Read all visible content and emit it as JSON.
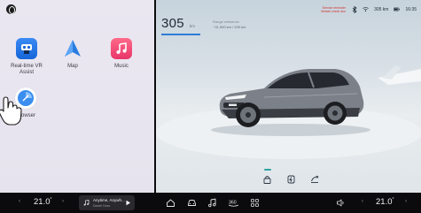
{
  "left_panel": {
    "apps": [
      {
        "label": "Real-time VR Assist",
        "icon": "vr-assist-icon"
      },
      {
        "label": "Map",
        "icon": "map-navigation-icon"
      },
      {
        "label": "Music",
        "icon": "music-note-icon"
      },
      {
        "label": "Browser",
        "icon": "browser-compass-icon"
      }
    ]
  },
  "main": {
    "range_value": "305",
    "range_unit": "km",
    "range_subtitle": "Range reference",
    "range_sub": "~31,900 km / 200 km",
    "status": {
      "warning_lines": [
        "Service reminder",
        "Vehicle check due"
      ],
      "range": "305 km",
      "time": "16:35"
    }
  },
  "dock": {
    "left_temp": "21.0",
    "right_temp": "21.0",
    "temp_unit": "°",
    "media_title": "Anytime, Anywh...",
    "media_artist": "Daniel Ceas"
  },
  "colors": {
    "accent_blue": "#2f7dd6",
    "teal": "#2fa3a0",
    "warning_red": "#d13030",
    "dock_bg": "#0b0b0d"
  }
}
